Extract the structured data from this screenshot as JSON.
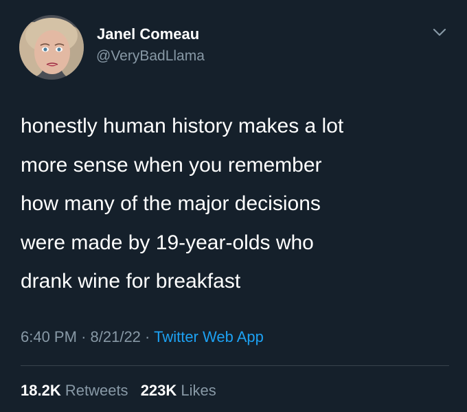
{
  "author": {
    "display_name": "Janel Comeau",
    "handle": "@VeryBadLlama",
    "avatar_icon": "profile-photo"
  },
  "tweet": {
    "lines": [
      "honestly human history makes a lot",
      "more sense when you remember",
      "how many of the major decisions",
      "were made by 19-year-olds who",
      "drank wine for breakfast"
    ]
  },
  "meta": {
    "time": "6:40 PM",
    "separator": "·",
    "date": "8/21/22",
    "source": "Twitter Web App"
  },
  "stats": {
    "retweets_count": "18.2K",
    "retweets_label": "Retweets",
    "likes_count": "223K",
    "likes_label": "Likes"
  },
  "colors": {
    "background": "#15202b",
    "text": "#ffffff",
    "secondary": "#8899a6",
    "link": "#1da1f2",
    "divider": "#38444d"
  },
  "icons": {
    "menu": "chevron-down-icon"
  }
}
